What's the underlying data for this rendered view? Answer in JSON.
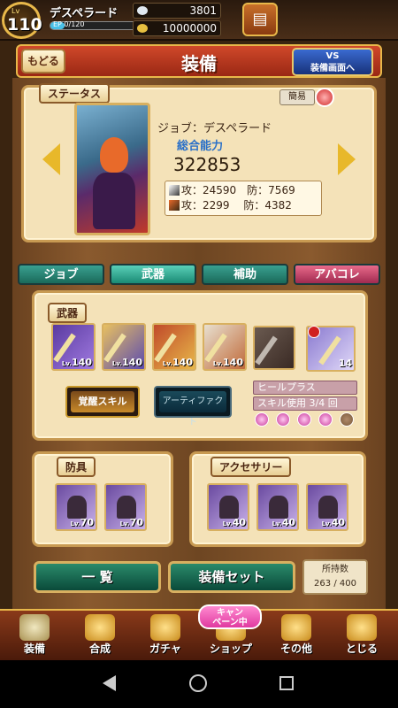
{
  "player": {
    "lv_label": "Lv",
    "level": "110",
    "name": "デスペラード",
    "exp_label": "EP 0/120",
    "exp_fraction": 0.15
  },
  "currency": {
    "gems": "3801",
    "gold": "10000000"
  },
  "header": {
    "back_label": "もどる",
    "title": "装備",
    "vs_line1": "VS",
    "vs_line2": "装備画面へ"
  },
  "status": {
    "tag": "ステータス",
    "simple_label": "簡易",
    "job_line": "ジョブ：デスペラード",
    "power_label": "総合能力",
    "power_value": "322853",
    "stat_row1": "攻：24590　防：7569",
    "stat_row2": "攻：2299　 防：4382"
  },
  "tabs": [
    {
      "label": "ジョブ"
    },
    {
      "label": "武器"
    },
    {
      "label": "補助"
    },
    {
      "label": "アバコレ"
    }
  ],
  "weapons": {
    "tag": "武器",
    "slots": [
      {
        "lv_prefix": "Lv.",
        "lv": "140"
      },
      {
        "lv_prefix": "Lv.",
        "lv": "140"
      },
      {
        "lv_prefix": "Lv.",
        "lv": "140"
      },
      {
        "lv_prefix": "Lv.",
        "lv": "140"
      },
      {
        "lv": ""
      },
      {
        "lv": "14"
      }
    ],
    "awaken_label": "覚醒スキル",
    "artifact_label": "アーティファクト",
    "skill_name": "ヒールプラス",
    "skill_use": "スキル使用 3/4 回",
    "skill_uses_filled": 4,
    "skill_uses_total": 5
  },
  "armor": {
    "tag": "防具",
    "items": [
      {
        "lv_prefix": "Lv.",
        "lv": "70"
      },
      {
        "lv_prefix": "Lv.",
        "lv": "70"
      }
    ]
  },
  "accessory": {
    "tag": "アクセサリー",
    "items": [
      {
        "lv_prefix": "Lv.",
        "lv": "40"
      },
      {
        "lv_prefix": "Lv.",
        "lv": "40"
      },
      {
        "lv_prefix": "Lv.",
        "lv": "40"
      }
    ]
  },
  "buttons": {
    "list": "一 覧",
    "set": "装備セット",
    "count_label": "所持数",
    "count_value": "263 / 400"
  },
  "nav": [
    {
      "label": "装備",
      "icon": "sword-shield-icon"
    },
    {
      "label": "合成",
      "icon": "hammer-icon"
    },
    {
      "label": "ガチャ",
      "icon": "gacha-icon"
    },
    {
      "label": "ショップ",
      "icon": "shop-icon"
    },
    {
      "label": "その他",
      "icon": "gear-icon"
    },
    {
      "label": "とじる",
      "icon": "close-icon"
    }
  ],
  "campaign": {
    "line1": "キャン",
    "line2": "ペーン中"
  }
}
